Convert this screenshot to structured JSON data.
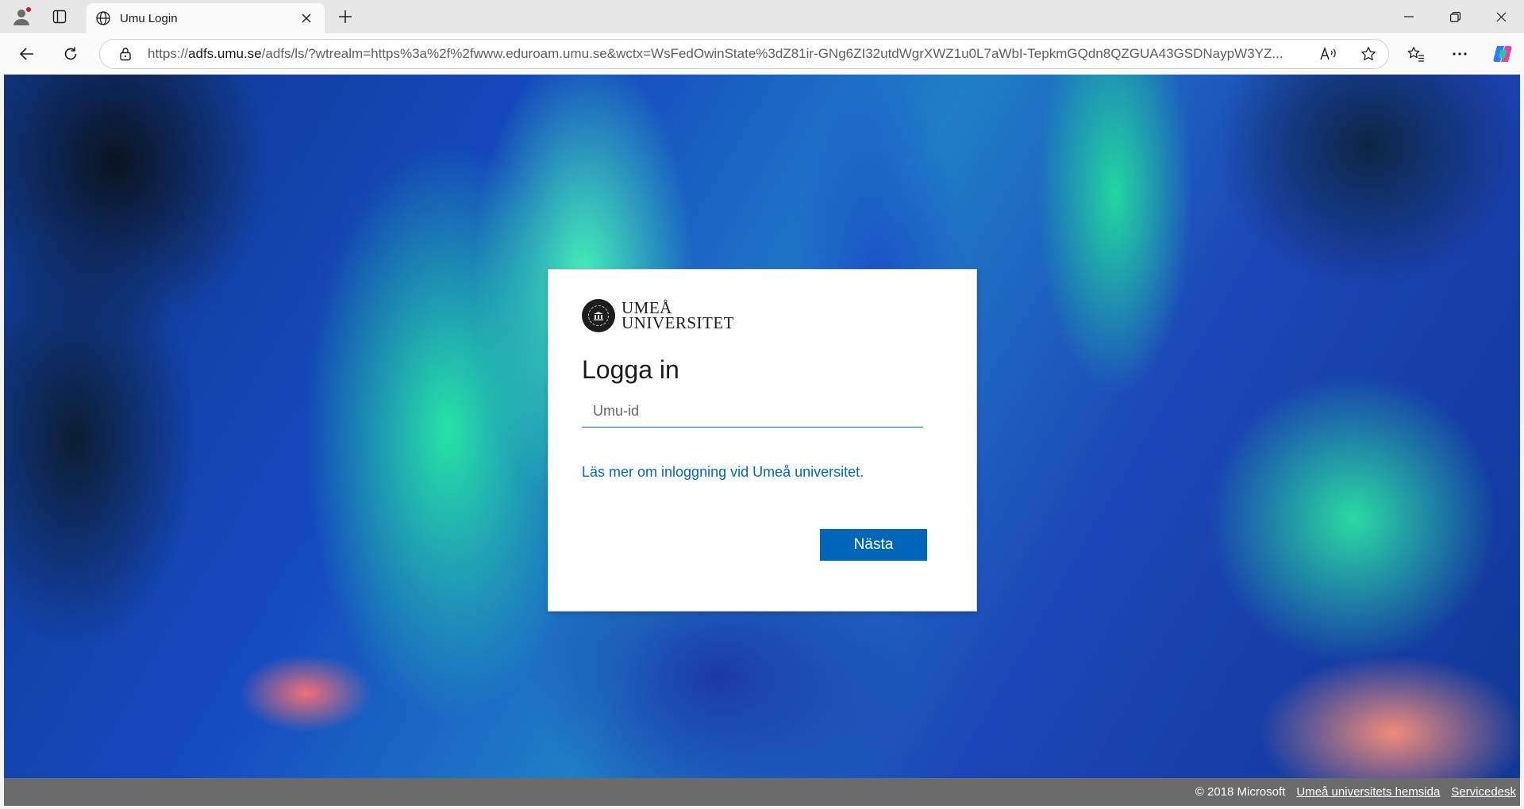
{
  "browser": {
    "tab": {
      "title": "Umu Login"
    },
    "url": {
      "prefix": "https://",
      "host": "adfs.umu.se",
      "rest": "/adfs/ls/?wtrealm=https%3a%2f%2fwww.eduroam.umu.se&wctx=WsFedOwinState%3dZ81ir-GNg6ZI32utdWgrXWZ1u0L7aWbI-TepkmGQdn8QZGUA43GSDNaypW3YZ..."
    },
    "icons": {
      "profile": "profile-icon",
      "tabs": "tab-actions-icon",
      "favicon": "globe-icon",
      "close": "close-icon",
      "newtab": "plus-icon",
      "minimize": "minimize-icon",
      "restore": "restore-icon",
      "window_close": "close-icon",
      "back": "back-arrow-icon",
      "refresh": "refresh-icon",
      "lock": "lock-icon",
      "read_aloud": "read-aloud-icon",
      "favorite": "star-icon",
      "favorites": "favorites-icon",
      "menu": "more-icon",
      "copilot": "copilot-icon"
    }
  },
  "login": {
    "logo_line1": "UMEÅ",
    "logo_line2": "UNIVERSITET",
    "title": "Logga in",
    "input_placeholder": "Umu-id",
    "input_value": "",
    "more_link": "Läs mer om inloggning vid Umeå universitet.",
    "next_button": "Nästa"
  },
  "footer": {
    "copyright": "© 2018 Microsoft",
    "homepage_link": "Umeå universitets hemsida",
    "servicedesk_link": "Servicedesk"
  },
  "colors": {
    "accent": "#0067b8",
    "footer_bg": "#6b6b6b",
    "titlebar_bg": "#e7e7e7"
  }
}
